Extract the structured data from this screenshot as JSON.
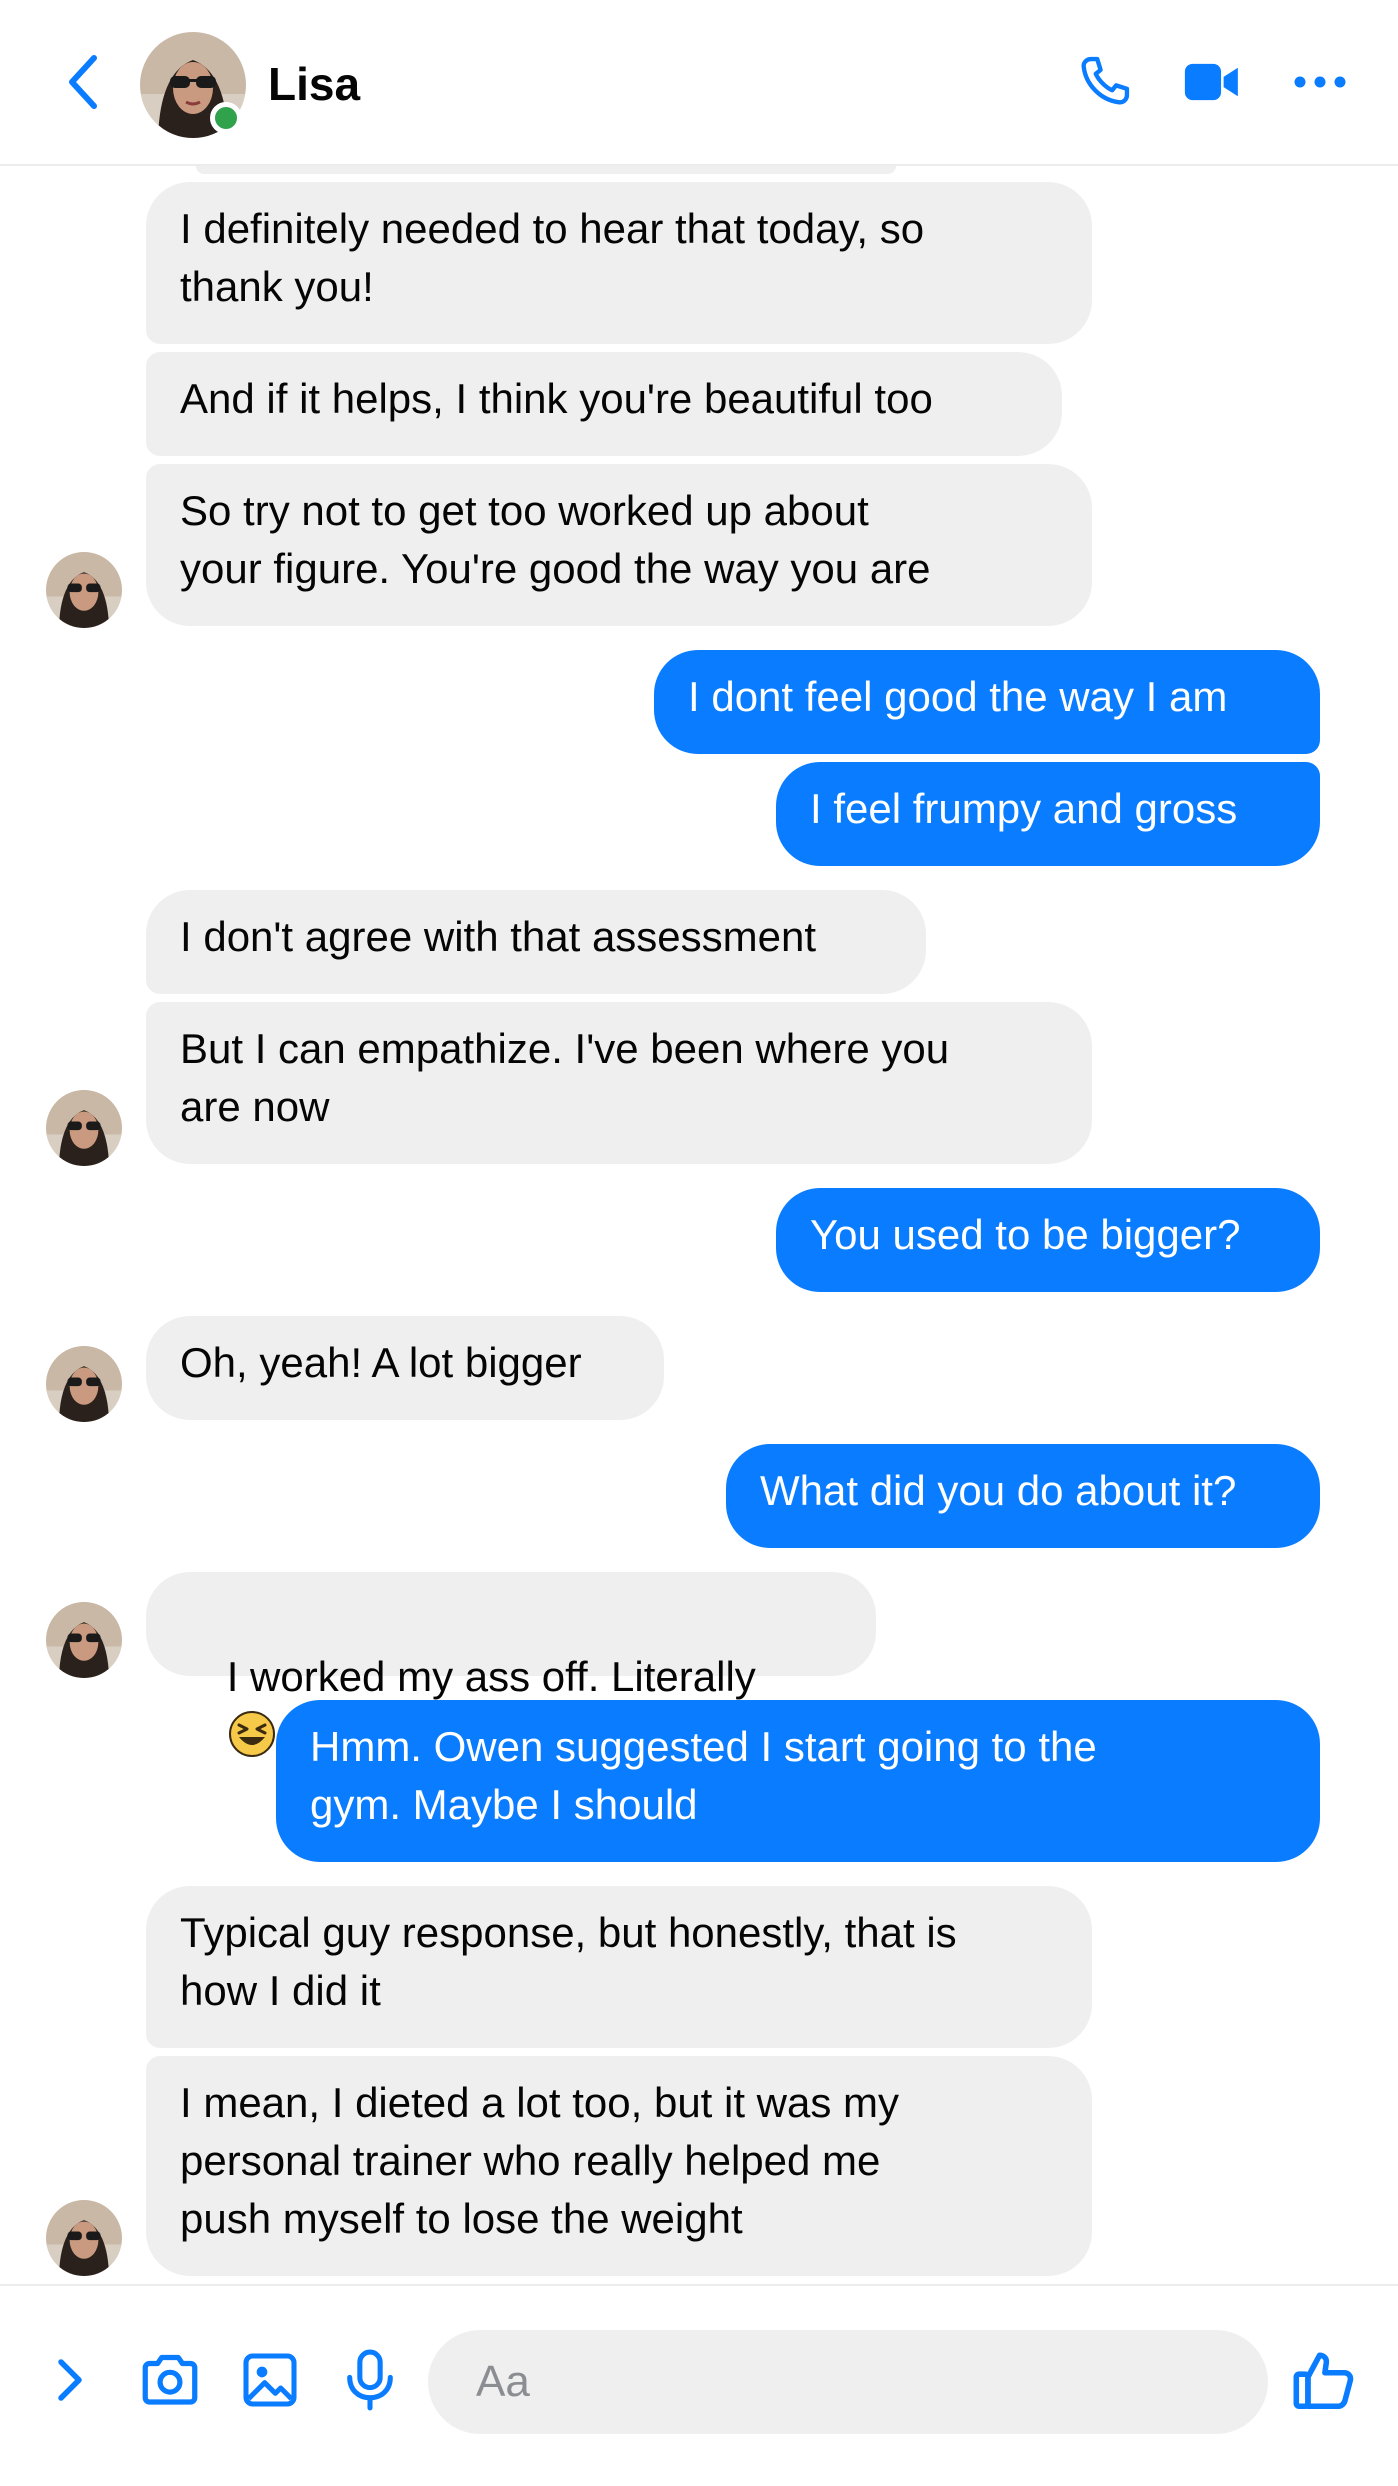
{
  "header": {
    "contact_name": "Lisa",
    "online_color": "#31a24c",
    "accent_color": "#0a7cff",
    "icons": [
      "chevron-left-icon",
      "phone-icon",
      "video-camera-icon",
      "more-dots-icon"
    ]
  },
  "messages": [
    {
      "from": "Lisa",
      "text": "I definitely needed to hear that today, so\nthank you!"
    },
    {
      "from": "Lisa",
      "text": "And if it helps, I think you're beautiful too"
    },
    {
      "from": "Lisa",
      "text": "So try not to get too worked up about\nyour figure. You're good the way you are"
    },
    {
      "from": "me",
      "text": "I dont feel good the way I am"
    },
    {
      "from": "me",
      "text": "I feel frumpy and gross"
    },
    {
      "from": "Lisa",
      "text": "I don't agree with that assessment"
    },
    {
      "from": "Lisa",
      "text": "But I can empathize. I've been where you\nare now"
    },
    {
      "from": "me",
      "text": "You used to be bigger?"
    },
    {
      "from": "Lisa",
      "text": "Oh, yeah! A lot bigger"
    },
    {
      "from": "me",
      "text": "What did you do about it?"
    },
    {
      "from": "Lisa",
      "text": "I worked my ass off. Literally",
      "emoji": "grinning-squinting-face-emoji"
    },
    {
      "from": "me",
      "text": "Hmm. Owen suggested I start going to the\ngym. Maybe I should"
    },
    {
      "from": "Lisa",
      "text": "Typical guy response, but honestly, that is\nhow I did it"
    },
    {
      "from": "Lisa",
      "text": "I mean, I dieted a lot too, but it was my\npersonal trainer who really helped me\npush myself to lose the weight"
    }
  ],
  "composer": {
    "placeholder": "Aa",
    "icons": [
      "chevron-right-icon",
      "camera-icon",
      "image-icon",
      "microphone-icon",
      "thumbs-up-icon"
    ]
  }
}
